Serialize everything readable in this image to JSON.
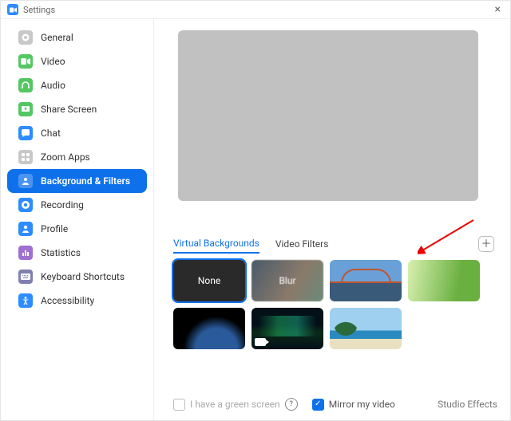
{
  "window": {
    "title": "Settings"
  },
  "sidebar": {
    "items": [
      {
        "label": "General",
        "icon": "gear-icon",
        "color": "#c0c0c0"
      },
      {
        "label": "Video",
        "icon": "video-icon",
        "color": "#53d769"
      },
      {
        "label": "Audio",
        "icon": "headphones-icon",
        "color": "#53d769"
      },
      {
        "label": "Share Screen",
        "icon": "share-screen-icon",
        "color": "#53d769"
      },
      {
        "label": "Chat",
        "icon": "chat-icon",
        "color": "#2d8cff"
      },
      {
        "label": "Zoom Apps",
        "icon": "apps-icon",
        "color": "#c0c0c0"
      },
      {
        "label": "Background & Filters",
        "icon": "background-icon",
        "color": "#ffffff",
        "active": true
      },
      {
        "label": "Recording",
        "icon": "record-icon",
        "color": "#2d8cff"
      },
      {
        "label": "Profile",
        "icon": "profile-icon",
        "color": "#2d8cff"
      },
      {
        "label": "Statistics",
        "icon": "stats-icon",
        "color": "#a070d0"
      },
      {
        "label": "Keyboard Shortcuts",
        "icon": "keyboard-icon",
        "color": "#8080b0"
      },
      {
        "label": "Accessibility",
        "icon": "accessibility-icon",
        "color": "#2d8cff"
      }
    ]
  },
  "tabs": {
    "virtual": "Virtual Backgrounds",
    "filters": "Video Filters"
  },
  "thumbs": {
    "none": "None",
    "blur": "Blur"
  },
  "bottom": {
    "green": "I have a green screen",
    "mirror": "Mirror my video",
    "studio": "Studio Effects"
  },
  "colors": {
    "accent": "#0e71eb"
  }
}
